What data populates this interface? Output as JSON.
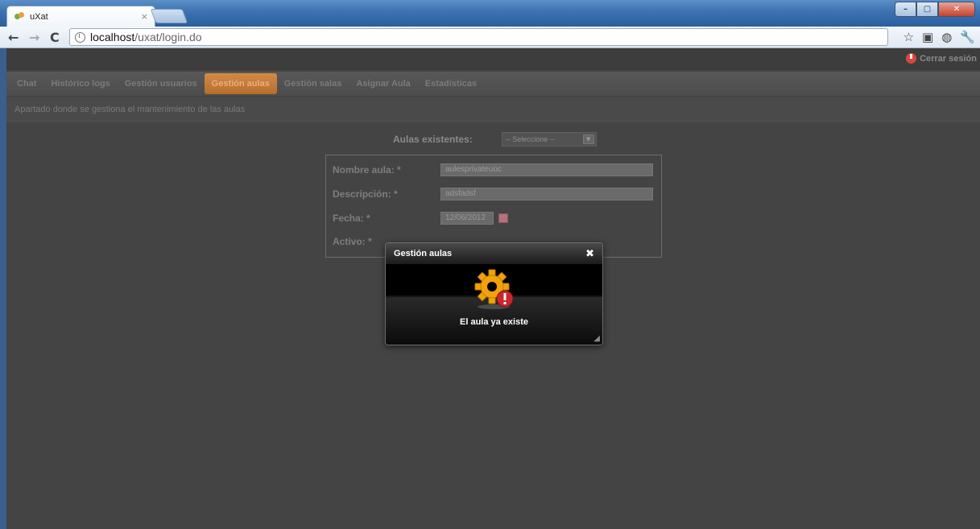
{
  "browser": {
    "tab_title": "uXat",
    "tab_close": "×",
    "url_host": "localhost",
    "url_path": "/uxat/login.do",
    "nav": {
      "back": "←",
      "forward": "→",
      "reload": "C"
    },
    "window_controls": {
      "minimize": "–",
      "maximize": "▢",
      "close": "✕"
    },
    "toolbar_icons": {
      "star": "☆",
      "ext1": "▣",
      "ext2": "◍",
      "wrench": "🔧"
    }
  },
  "app": {
    "logout_label": "Cerrar sesión",
    "menu": [
      {
        "label": "Chat",
        "active": false
      },
      {
        "label": "Histórico logs",
        "active": false
      },
      {
        "label": "Gestión usuarios",
        "active": false
      },
      {
        "label": "Gestión aulas",
        "active": true
      },
      {
        "label": "Gestión salas",
        "active": false
      },
      {
        "label": "Asignar Aula",
        "active": false
      },
      {
        "label": "Estadísticas",
        "active": false
      }
    ],
    "subtitle": "Apartado donde se gestiona el mantenimiento de las aulas",
    "existing": {
      "label": "Aulas existentes:",
      "select_value": "-- Seleccione --"
    },
    "form": {
      "name_label": "Nombre aula: *",
      "name_value": "aulesprivateuoc",
      "desc_label": "Descripción: *",
      "desc_value": "adsfadsf",
      "date_label": "Fecha: *",
      "date_value": "12/06/2012",
      "active_label": "Activo: *"
    }
  },
  "modal": {
    "title": "Gestión aulas",
    "close": "✖",
    "message": "El aula ya existe"
  },
  "colors": {
    "accent_tab": "#c57a38",
    "page_bg": "#444444",
    "error_red": "#c8272b",
    "gear_orange": "#f2a20c"
  }
}
